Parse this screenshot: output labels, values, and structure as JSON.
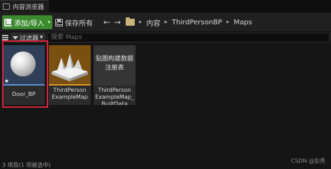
{
  "tab": {
    "label": "内容浏览器"
  },
  "toolbar": {
    "add_import_label": "添加/导入",
    "save_all_label": "保存所有",
    "back_glyph": "←",
    "forward_glyph": "→"
  },
  "breadcrumb": {
    "items": [
      "内容",
      "ThirdPersonBP",
      "Maps"
    ],
    "separator": "▸"
  },
  "filterbar": {
    "filters_label": "过滤器",
    "search_placeholder": "搜索 Maps"
  },
  "assets": [
    {
      "label": "Door_BP",
      "type_icon": "blueprint-sphere",
      "selected": true
    },
    {
      "label": "ThirdPerson ExampleMap",
      "type_icon": "map-thumbnail"
    },
    {
      "label": "ThirdPerson ExampleMap_ BuiltData",
      "thumb_text": "贴图构建数据注册表"
    }
  ],
  "status": {
    "text": "3 项目(1 项被选中)"
  },
  "watermark": "CSDN @彭秀",
  "colors": {
    "selection_border": "#d9233f",
    "add_button": "#3b8a2d",
    "blueprint_thumb": "#2f3f59",
    "map_thumb": "#7a4f10"
  }
}
